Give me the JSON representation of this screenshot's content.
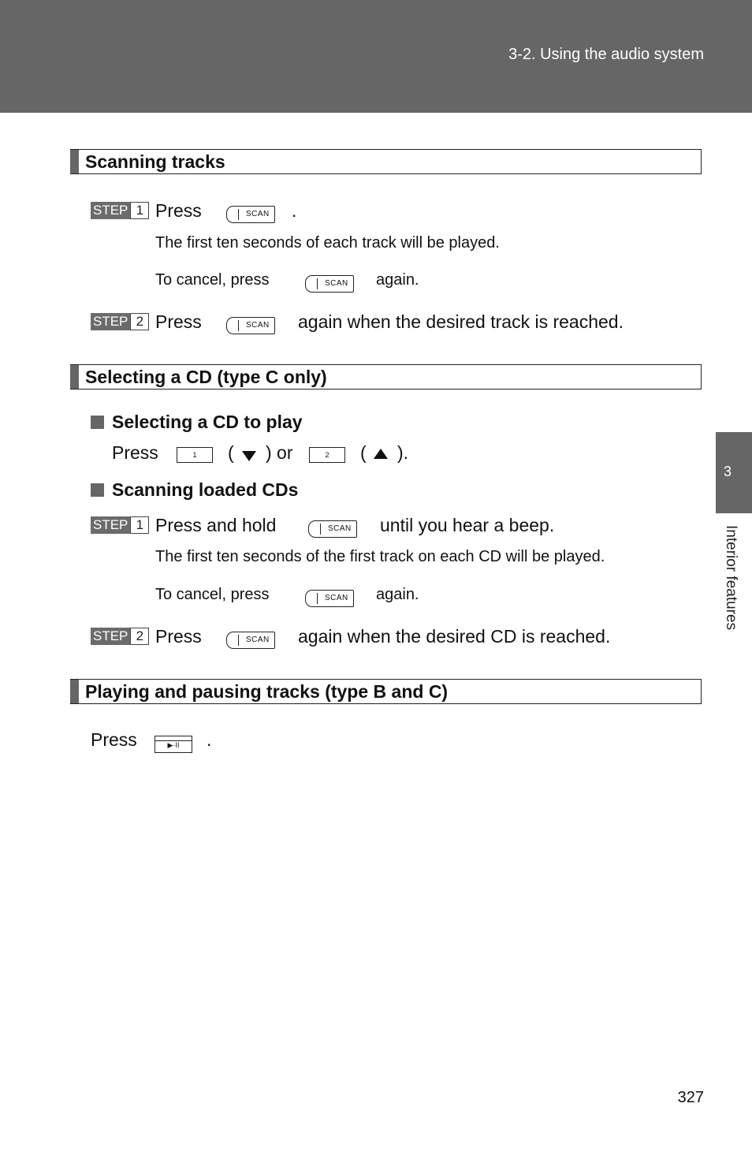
{
  "header": {
    "title": "3-2. Using the audio system"
  },
  "side_tab": {
    "number": "3",
    "label": "Interior features"
  },
  "page_number": "327",
  "buttons": {
    "scan": "SCAN",
    "one": "1",
    "two": "2",
    "play_pause": "▶·II"
  },
  "sections": [
    {
      "title": "Scanning tracks",
      "steps": [
        {
          "step_label": "STEP",
          "num": "1",
          "text_before": "Press",
          "text_after": ".",
          "notes": [
            "The first ten seconds of each track will be played."
          ],
          "cancel_before": "To cancel, press",
          "cancel_after": "again."
        },
        {
          "step_label": "STEP",
          "num": "2",
          "text_before": "Press",
          "text_after": "again when the desired track is reached."
        }
      ]
    },
    {
      "title": "Selecting a CD (type C only)",
      "sub1": {
        "heading": "Selecting a CD to play",
        "press": "Press",
        "paren_open": "(",
        "or": ") or",
        "paren_open2": "(",
        "close": ")."
      },
      "sub2": {
        "heading": "Scanning loaded CDs"
      },
      "steps": [
        {
          "step_label": "STEP",
          "num": "1",
          "text_before": "Press and hold",
          "text_after": "until you hear a beep.",
          "notes": [
            "The first ten seconds of the first track on each CD will be played."
          ],
          "cancel_before": "To cancel, press",
          "cancel_after": "again."
        },
        {
          "step_label": "STEP",
          "num": "2",
          "text_before": "Press",
          "text_after": "again when the desired CD is reached."
        }
      ]
    },
    {
      "title": "Playing and pausing tracks (type B and C)",
      "press": "Press",
      "after": "."
    }
  ]
}
